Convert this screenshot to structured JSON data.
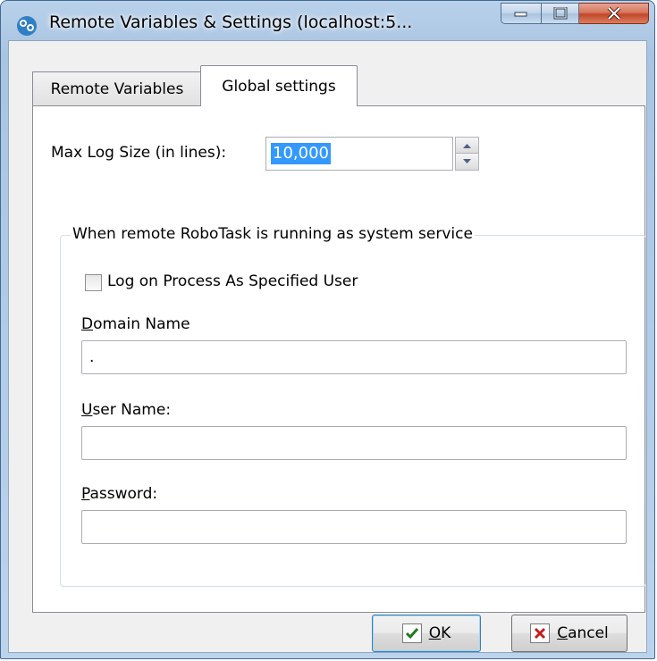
{
  "window": {
    "title": "Remote Variables & Settings (localhost:5...",
    "icon": "robotask-app-icon"
  },
  "caption_buttons": {
    "minimize_icon": "minimize-icon",
    "maximize_icon": "maximize-icon",
    "close_icon": "close-icon"
  },
  "tabs": [
    {
      "label": "Remote Variables",
      "active": false
    },
    {
      "label": "Global settings",
      "active": true
    }
  ],
  "global_settings": {
    "max_log_label": "Max Log Size (in lines):",
    "max_log_value": "10,000",
    "group_title": "When remote RoboTask is running as system service",
    "log_on_checkbox": {
      "label": "Log on Process As Specified User",
      "checked": false
    },
    "domain": {
      "label_first": "D",
      "label_rest": "omain Name",
      "value": "."
    },
    "user": {
      "label_first": "U",
      "label_rest": "ser Name:",
      "value": ""
    },
    "password": {
      "label_first": "P",
      "label_rest": "assword:",
      "value": ""
    }
  },
  "buttons": {
    "ok": {
      "label_first": "O",
      "label_rest": "K",
      "icon": "checkmark-icon"
    },
    "cancel": {
      "label_first": "C",
      "label_rest": "ancel",
      "icon": "x-icon"
    }
  },
  "colors": {
    "title_bar": "#b9d1ea",
    "selection": "#3399ff",
    "close_button": "#c3462b"
  }
}
